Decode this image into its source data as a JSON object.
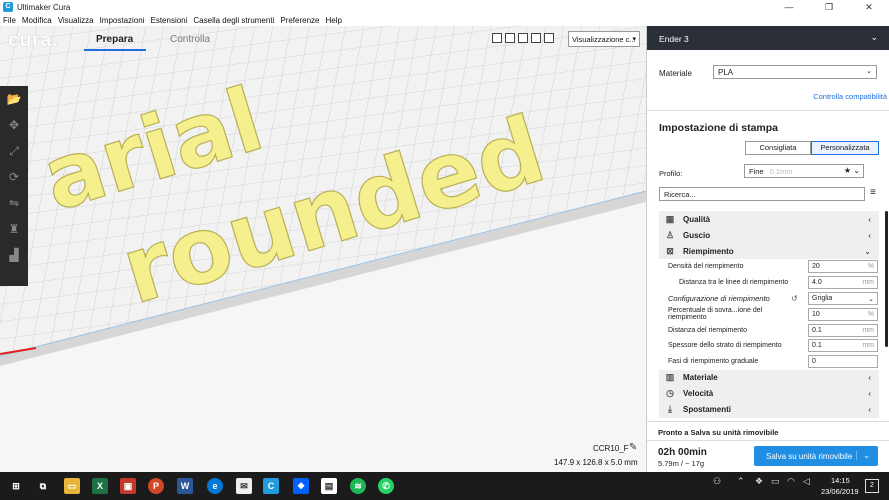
{
  "window": {
    "title": "Ultimaker Cura"
  },
  "menu": [
    "File",
    "Modifica",
    "Visualizza",
    "Impostazioni",
    "Estensioni",
    "Casella degli strumenti",
    "Preferenze",
    "Help"
  ],
  "header": {
    "logo": "cura.",
    "stages": {
      "prepare": "Prepara",
      "monitor": "Controlla"
    },
    "view_select": "Visualizzazione c..."
  },
  "viewport": {
    "text_line1": "arial",
    "text_line2": "rounded",
    "model_color": "#f5ef8e",
    "file_name": "CCR10_F",
    "dimensions": "147.9 x 126.8 x 5.0 mm"
  },
  "panel": {
    "printer": "Ender 3",
    "material_label": "Materiale",
    "material_value": "PLA",
    "compat_link": "Controlla compatibilità",
    "setup_title": "Impostazione di stampa",
    "mode_recommended": "Consigliata",
    "mode_custom": "Personalizzata",
    "profile_label": "Profilo:",
    "profile_value": "Fine",
    "profile_sub": "0.1mm",
    "search_placeholder": "Ricerca...",
    "categories_top": [
      {
        "label": "Qualità",
        "icon": "quality-icon",
        "glyph": "▦"
      },
      {
        "label": "Guscio",
        "icon": "shell-icon",
        "glyph": "♙"
      },
      {
        "label": "Riempimento",
        "icon": "infill-icon",
        "glyph": "⊠"
      }
    ],
    "infill_settings": [
      {
        "label": "Densità del riempimento",
        "value": "20",
        "unit": "%"
      },
      {
        "label": "Distanza tra le linee di riempimento",
        "value": "4.0",
        "unit": "mm"
      },
      {
        "label": "Configurazione di riempimento",
        "value": "Griglia",
        "unit": ""
      },
      {
        "label": "Percentuale di sovra...ione del riempimento",
        "value": "10",
        "unit": "%"
      },
      {
        "label": "Distanza del riempimento",
        "value": "0.1",
        "unit": "mm"
      },
      {
        "label": "Spessore dello strato di riempimento",
        "value": "0.1",
        "unit": "mm"
      },
      {
        "label": "Fasi di riempimento graduale",
        "value": "0",
        "unit": ""
      }
    ],
    "categories_bottom": [
      {
        "label": "Materiale",
        "icon": "material-icon",
        "glyph": "|||"
      },
      {
        "label": "Velocità",
        "icon": "speed-icon",
        "glyph": "◷"
      },
      {
        "label": "Spostamenti",
        "icon": "travel-icon",
        "glyph": "⤓"
      }
    ],
    "ready_text": "Pronto a Salva su unità rimovibile",
    "print_time": "02h 00min",
    "material_usage": "5.79m / ~ 17g",
    "save_button": "Salva su unità rimovibile"
  },
  "taskbar": {
    "time": "14:15",
    "date": "23/06/2019",
    "notifications": "2"
  }
}
